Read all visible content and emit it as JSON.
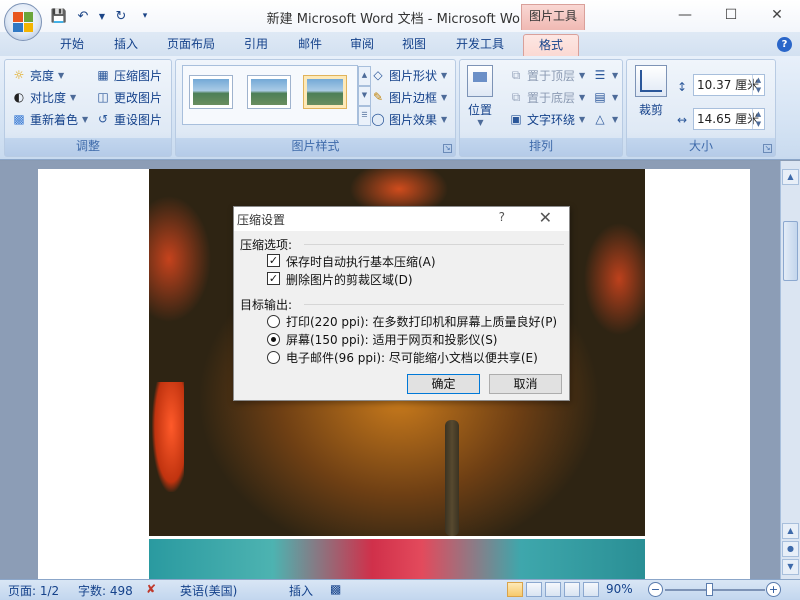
{
  "title_bar": {
    "title": "新建 Microsoft Word 文档 - Microsoft Word",
    "context_tab_header": "图片工具",
    "quick_access": [
      "save-icon",
      "undo-icon",
      "redo-icon",
      "customize-icon"
    ]
  },
  "tabs": [
    {
      "label": "开始"
    },
    {
      "label": "插入"
    },
    {
      "label": "页面布局"
    },
    {
      "label": "引用"
    },
    {
      "label": "邮件"
    },
    {
      "label": "审阅"
    },
    {
      "label": "视图"
    },
    {
      "label": "开发工具"
    },
    {
      "label": "格式",
      "active": true
    }
  ],
  "ribbon": {
    "adjust": {
      "label": "调整",
      "brightness": "亮度",
      "contrast": "对比度",
      "recolor": "重新着色",
      "compress": "压缩图片",
      "change": "更改图片",
      "reset": "重设图片"
    },
    "picture_styles": {
      "label": "图片样式",
      "shape": "图片形状",
      "border": "图片边框",
      "effects": "图片效果"
    },
    "arrange": {
      "label": "排列",
      "position": "位置",
      "bring_front": "置于顶层",
      "send_back": "置于底层",
      "wrap": "文字环绕"
    },
    "size": {
      "label": "大小",
      "crop": "裁剪",
      "height": "10.37 厘米",
      "width": "14.65 厘米"
    }
  },
  "dialog": {
    "title": "压缩设置",
    "help": "?",
    "section1": "压缩选项:",
    "options": [
      {
        "label": "保存时自动执行基本压缩(A)",
        "checked": true
      },
      {
        "label": "删除图片的剪裁区域(D)",
        "checked": true
      }
    ],
    "section2": "目标输出:",
    "targets": [
      {
        "label": "打印(220 ppi): 在多数打印机和屏幕上质量良好(P)",
        "selected": false
      },
      {
        "label": "屏幕(150 ppi): 适用于网页和投影仪(S)",
        "selected": true
      },
      {
        "label": "电子邮件(96 ppi): 尽可能缩小文档以便共享(E)",
        "selected": false
      }
    ],
    "ok": "确定",
    "cancel": "取消"
  },
  "status": {
    "page": "页面: 1/2",
    "words": "字数: 498",
    "language": "英语(美国)",
    "insert": "插入",
    "zoom": "90%"
  }
}
